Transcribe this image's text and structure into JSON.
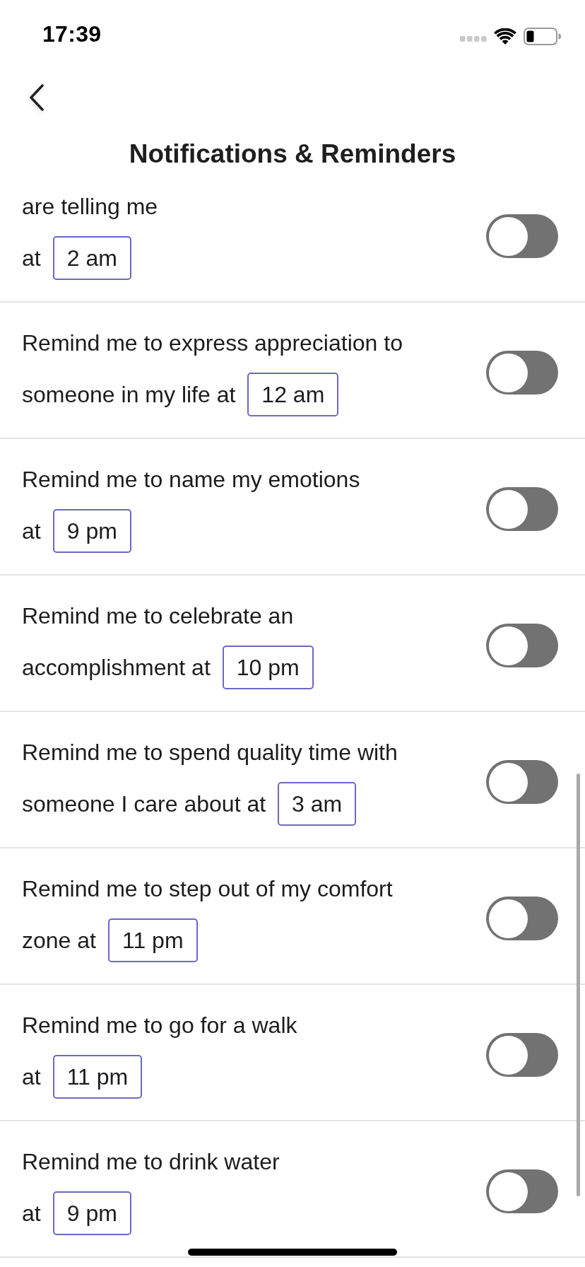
{
  "status_bar": {
    "time": "17:39"
  },
  "nav": {
    "title": "Notifications & Reminders"
  },
  "reminders": [
    {
      "lines": [
        "are telling me",
        "at"
      ],
      "time": "2 am",
      "on": false
    },
    {
      "lines": [
        "Remind me to express appreciation to",
        "someone in my life at"
      ],
      "time": "12 am",
      "on": false
    },
    {
      "lines": [
        "Remind me to name my emotions",
        "at"
      ],
      "time": "9 pm",
      "on": false
    },
    {
      "lines": [
        "Remind me to celebrate an",
        "accomplishment at"
      ],
      "time": "10 pm",
      "on": false
    },
    {
      "lines": [
        "Remind me to spend quality time with",
        "someone I care about at"
      ],
      "time": "3 am",
      "on": false
    },
    {
      "lines": [
        "Remind me to step out of my comfort",
        "zone at"
      ],
      "time": "11 pm",
      "on": false
    },
    {
      "lines": [
        "Remind me to go for a walk",
        "at"
      ],
      "time": "11 pm",
      "on": false
    },
    {
      "lines": [
        "Remind me to drink water",
        "at"
      ],
      "time": "9 pm",
      "on": false
    }
  ]
}
